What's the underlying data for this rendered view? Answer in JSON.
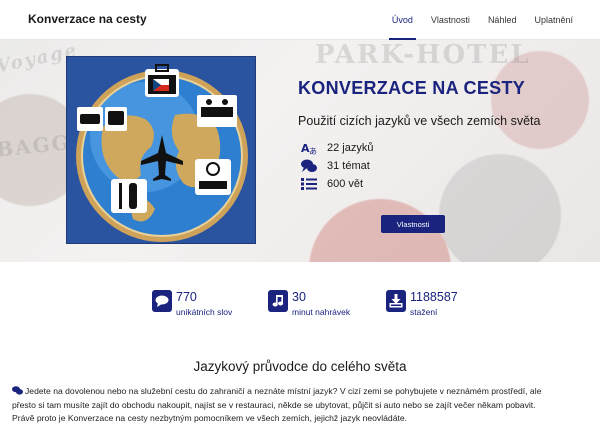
{
  "header": {
    "brand": "Konverzace na cesty",
    "nav": [
      {
        "label": "Úvod",
        "active": true
      },
      {
        "label": "Vlastnosti",
        "active": false
      },
      {
        "label": "Náhled",
        "active": false
      },
      {
        "label": "Uplatnění",
        "active": false
      }
    ]
  },
  "hero": {
    "title": "KONVERZACE NA CESTY",
    "subtitle": "Použití cizích jazyků ve všech zemích světa",
    "features": [
      {
        "icon": "translate-icon",
        "text": "22 jazyků"
      },
      {
        "icon": "chat-bubbles-icon",
        "text": "31 témat"
      },
      {
        "icon": "list-icon",
        "text": "600 vět"
      }
    ],
    "button_label": "Vlastnosti",
    "background_stamps": [
      "PARK-HOTEL",
      "Voyage",
      "BAGGAG"
    ]
  },
  "stats": [
    {
      "icon": "chat-icon",
      "value": "770",
      "label": "unikátních slov"
    },
    {
      "icon": "music-note-icon",
      "value": "30",
      "label": "minut nahrávek"
    },
    {
      "icon": "download-icon",
      "value": "1188587",
      "label": "stažení"
    }
  ],
  "section": {
    "title": "Jazykový průvodce do celého světa",
    "lines": [
      "Jedete na dovolenou nebo na služební cestu do zahraničí a neznáte místní jazyk? V cizí zemi se pohybujete v neznámém prostředí, ale",
      "přesto si tam musíte zajít do obchodu nakoupit, najíst se v restauraci, někde se ubytovat, půjčit si auto nebo se zajít večer někam pobavit.",
      "Právě proto je Konverzace na cesty nezbytným pomocníkem ve všech zemích, jejichž jazyk neovládáte."
    ]
  },
  "colors": {
    "accent": "#1a237e",
    "poster_bg": "#2a4f97",
    "globe_ocean": "#2f7fd0",
    "globe_land": "#caa45a"
  }
}
